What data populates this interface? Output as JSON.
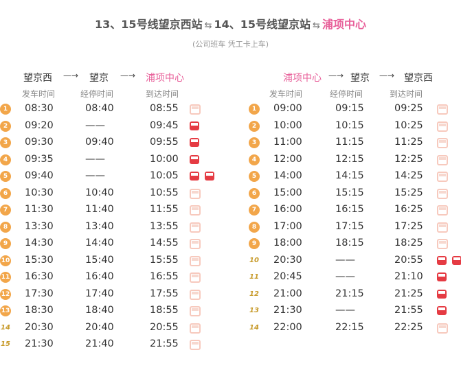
{
  "header": {
    "title_part1": "13、15号线望京西站",
    "title_part2": "14、15号线望京站",
    "title_part3": "浦项中心",
    "arrow": "⇆",
    "subtitle": "(公司班车  凭工卡上车)"
  },
  "colors": {
    "pink": "#e8609a",
    "orange": "#f2a64a",
    "red_bus": "#e53b43",
    "light_bus": "#f7c9bd"
  },
  "left": {
    "route": {
      "from": "望京西",
      "via": "望京",
      "to": "浦项中心",
      "arrow": "—→"
    },
    "headers": {
      "depart": "发车时间",
      "stop": "经停时间",
      "arrive": "到达时间"
    },
    "rows": [
      {
        "n": "1",
        "depart": "08:30",
        "stop": "08:40",
        "arrive": "08:55",
        "bus": "light",
        "night": false
      },
      {
        "n": "2",
        "depart": "09:20",
        "stop": "——",
        "arrive": "09:45",
        "bus": "red",
        "night": false
      },
      {
        "n": "3",
        "depart": "09:30",
        "stop": "09:40",
        "arrive": "09:55",
        "bus": "red",
        "night": false
      },
      {
        "n": "4",
        "depart": "09:35",
        "stop": "——",
        "arrive": "10:00",
        "bus": "red",
        "night": false
      },
      {
        "n": "5",
        "depart": "09:40",
        "stop": "——",
        "arrive": "10:05",
        "bus": "red2",
        "night": false
      },
      {
        "n": "6",
        "depart": "10:30",
        "stop": "10:40",
        "arrive": "10:55",
        "bus": "light",
        "night": false
      },
      {
        "n": "7",
        "depart": "11:30",
        "stop": "11:40",
        "arrive": "11:55",
        "bus": "light",
        "night": false
      },
      {
        "n": "8",
        "depart": "13:30",
        "stop": "13:40",
        "arrive": "13:55",
        "bus": "light",
        "night": false
      },
      {
        "n": "9",
        "depart": "14:30",
        "stop": "14:40",
        "arrive": "14:55",
        "bus": "light",
        "night": false
      },
      {
        "n": "10",
        "depart": "15:30",
        "stop": "15:40",
        "arrive": "15:55",
        "bus": "light",
        "night": false
      },
      {
        "n": "11",
        "depart": "16:30",
        "stop": "16:40",
        "arrive": "16:55",
        "bus": "light",
        "night": false
      },
      {
        "n": "12",
        "depart": "17:30",
        "stop": "17:40",
        "arrive": "17:55",
        "bus": "light",
        "night": false
      },
      {
        "n": "13",
        "depart": "18:30",
        "stop": "18:40",
        "arrive": "18:55",
        "bus": "light",
        "night": false
      },
      {
        "n": "14",
        "depart": "20:30",
        "stop": "20:40",
        "arrive": "20:55",
        "bus": "light",
        "night": true
      },
      {
        "n": "15",
        "depart": "21:30",
        "stop": "21:40",
        "arrive": "21:55",
        "bus": "light",
        "night": true
      }
    ]
  },
  "right": {
    "route": {
      "from": "浦项中心",
      "via": "望京",
      "to": "望京西",
      "arrow": "—→"
    },
    "headers": {
      "depart": "发车时间",
      "stop": "经停时间",
      "arrive": "到达时间"
    },
    "rows": [
      {
        "n": "1",
        "depart": "09:00",
        "stop": "09:15",
        "arrive": "09:25",
        "bus": "light",
        "night": false
      },
      {
        "n": "2",
        "depart": "10:00",
        "stop": "10:15",
        "arrive": "10:25",
        "bus": "light",
        "night": false
      },
      {
        "n": "3",
        "depart": "11:00",
        "stop": "11:15",
        "arrive": "11:25",
        "bus": "light",
        "night": false
      },
      {
        "n": "4",
        "depart": "12:00",
        "stop": "12:15",
        "arrive": "12:25",
        "bus": "light",
        "night": false
      },
      {
        "n": "5",
        "depart": "14:00",
        "stop": "14:15",
        "arrive": "14:25",
        "bus": "light",
        "night": false
      },
      {
        "n": "6",
        "depart": "15:00",
        "stop": "15:15",
        "arrive": "15:25",
        "bus": "light",
        "night": false
      },
      {
        "n": "7",
        "depart": "16:00",
        "stop": "16:15",
        "arrive": "16:25",
        "bus": "light",
        "night": false
      },
      {
        "n": "8",
        "depart": "17:00",
        "stop": "17:15",
        "arrive": "17:25",
        "bus": "light",
        "night": false
      },
      {
        "n": "9",
        "depart": "18:00",
        "stop": "18:15",
        "arrive": "18:25",
        "bus": "light",
        "night": false
      },
      {
        "n": "10",
        "depart": "20:30",
        "stop": "——",
        "arrive": "20:55",
        "bus": "red2",
        "night": true
      },
      {
        "n": "11",
        "depart": "20:45",
        "stop": "——",
        "arrive": "21:10",
        "bus": "red",
        "night": true
      },
      {
        "n": "12",
        "depart": "21:00",
        "stop": "21:15",
        "arrive": "21:25",
        "bus": "red",
        "night": true
      },
      {
        "n": "13",
        "depart": "21:30",
        "stop": "——",
        "arrive": "21:55",
        "bus": "red",
        "night": true
      },
      {
        "n": "14",
        "depart": "22:00",
        "stop": "22:15",
        "arrive": "22:25",
        "bus": "light",
        "night": true
      }
    ]
  }
}
